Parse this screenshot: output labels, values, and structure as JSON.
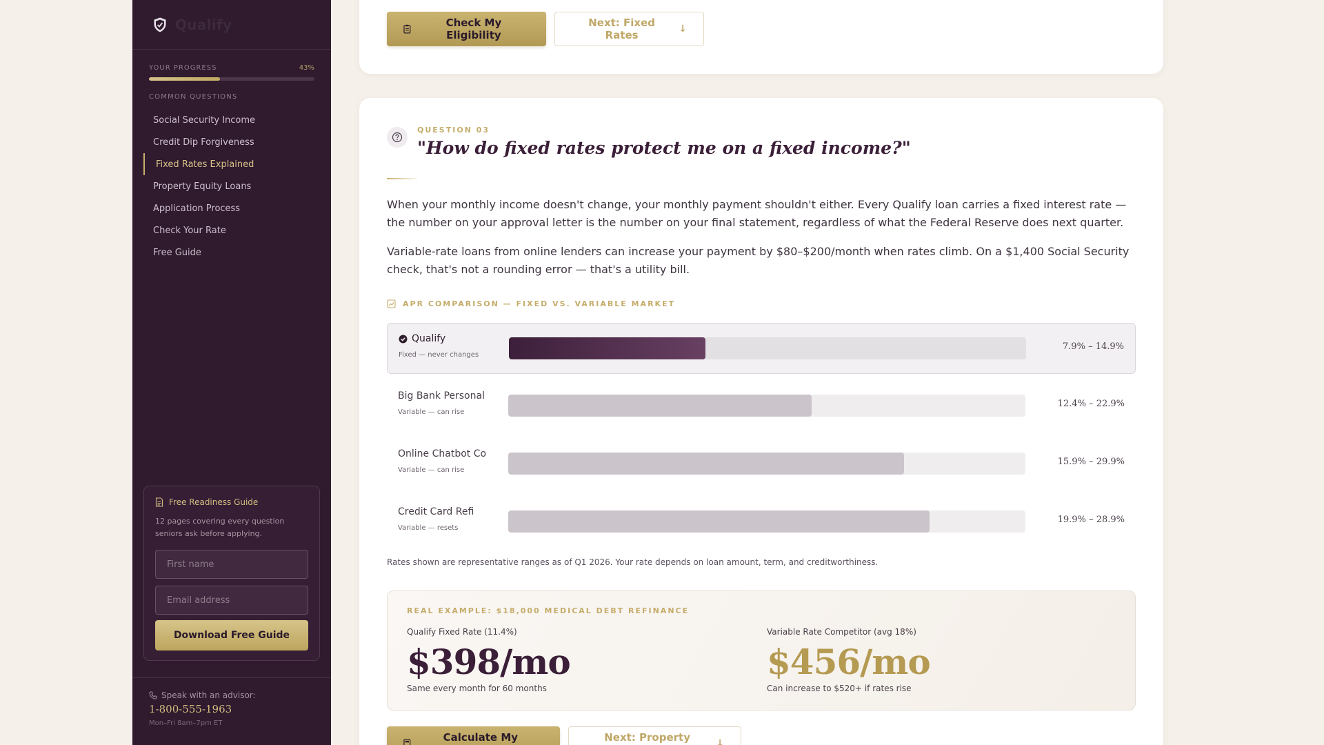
{
  "brand": {
    "name": "Qualify"
  },
  "progress": {
    "label": "YOUR PROGRESS",
    "percent_text": "43%",
    "fraction": 0.43
  },
  "nav": {
    "section_label": "COMMON QUESTIONS",
    "items": [
      {
        "label": "Social Security Income"
      },
      {
        "label": "Credit Dip Forgiveness"
      },
      {
        "label": "Fixed Rates Explained",
        "active": true
      },
      {
        "label": "Property Equity Loans"
      },
      {
        "label": "Application Process"
      },
      {
        "label": "Check Your Rate"
      },
      {
        "label": "Free Guide"
      }
    ]
  },
  "guide": {
    "title": "Free Readiness Guide",
    "description": "12 pages covering every question seniors ask before applying.",
    "first_name_placeholder": "First name",
    "email_placeholder": "Email address",
    "button_label": "Download Free Guide"
  },
  "advisor": {
    "label": "Speak with an advisor:",
    "phone": "1-800-555-1963",
    "hours": "Mon–Fri 8am–7pm ET"
  },
  "top_actions": {
    "primary_label": "Check My Eligibility",
    "secondary_label": "Next: Fixed Rates"
  },
  "question": {
    "number_label": "QUESTION 03",
    "title": "\"How do fixed rates protect me on a fixed income?\"",
    "paragraph_1": "When your monthly income doesn't change, your monthly payment shouldn't either. Every Qualify loan carries a fixed interest rate — the number on your approval letter is the number on your final statement, regardless of what the Federal Reserve does next quarter.",
    "paragraph_2": "Variable-rate loans from online lenders can increase your payment by $80–$200/month when rates climb. On a $1,400 Social Security check, that's not a rounding error — that's a utility bill."
  },
  "comparison": {
    "label": "APR COMPARISON — FIXED VS. VARIABLE MARKET",
    "rows": [
      {
        "name": "Qualify",
        "sub": "Fixed — never changes",
        "range": "7.9% – 14.9%",
        "fill": 0.38,
        "highlight": true
      },
      {
        "name": "Big Bank Personal",
        "sub": "Variable — can rise",
        "range": "12.4% – 22.9%",
        "fill": 0.587
      },
      {
        "name": "Online Chatbot Co",
        "sub": "Variable — can rise",
        "range": "15.9% – 29.9%",
        "fill": 0.765
      },
      {
        "name": "Credit Card Refi",
        "sub": "Variable — resets",
        "range": "19.9% – 28.9%",
        "fill": 0.815
      }
    ],
    "footnote": "Rates shown are representative ranges as of Q1 2026. Your rate depends on loan amount, term, and creditworthiness."
  },
  "example": {
    "label": "REAL EXAMPLE: $18,000 MEDICAL DEBT REFINANCE",
    "left": {
      "caption": "Qualify Fixed Rate (11.4%)",
      "amount": "$398/mo",
      "note": "Same every month for 60 months"
    },
    "right": {
      "caption": "Variable Rate Competitor (avg 18%)",
      "amount": "$456/mo",
      "note": "Can increase to $520+ if rates rise"
    }
  },
  "bottom_actions": {
    "primary_label": "Calculate My Payment",
    "secondary_label": "Next: Property Equity"
  },
  "colors": {
    "sidebar_bg": "#2f1a2e",
    "accent_gold": "#c9b06a",
    "plum": "#3b1f38",
    "page_bg": "#f5f0ea"
  }
}
